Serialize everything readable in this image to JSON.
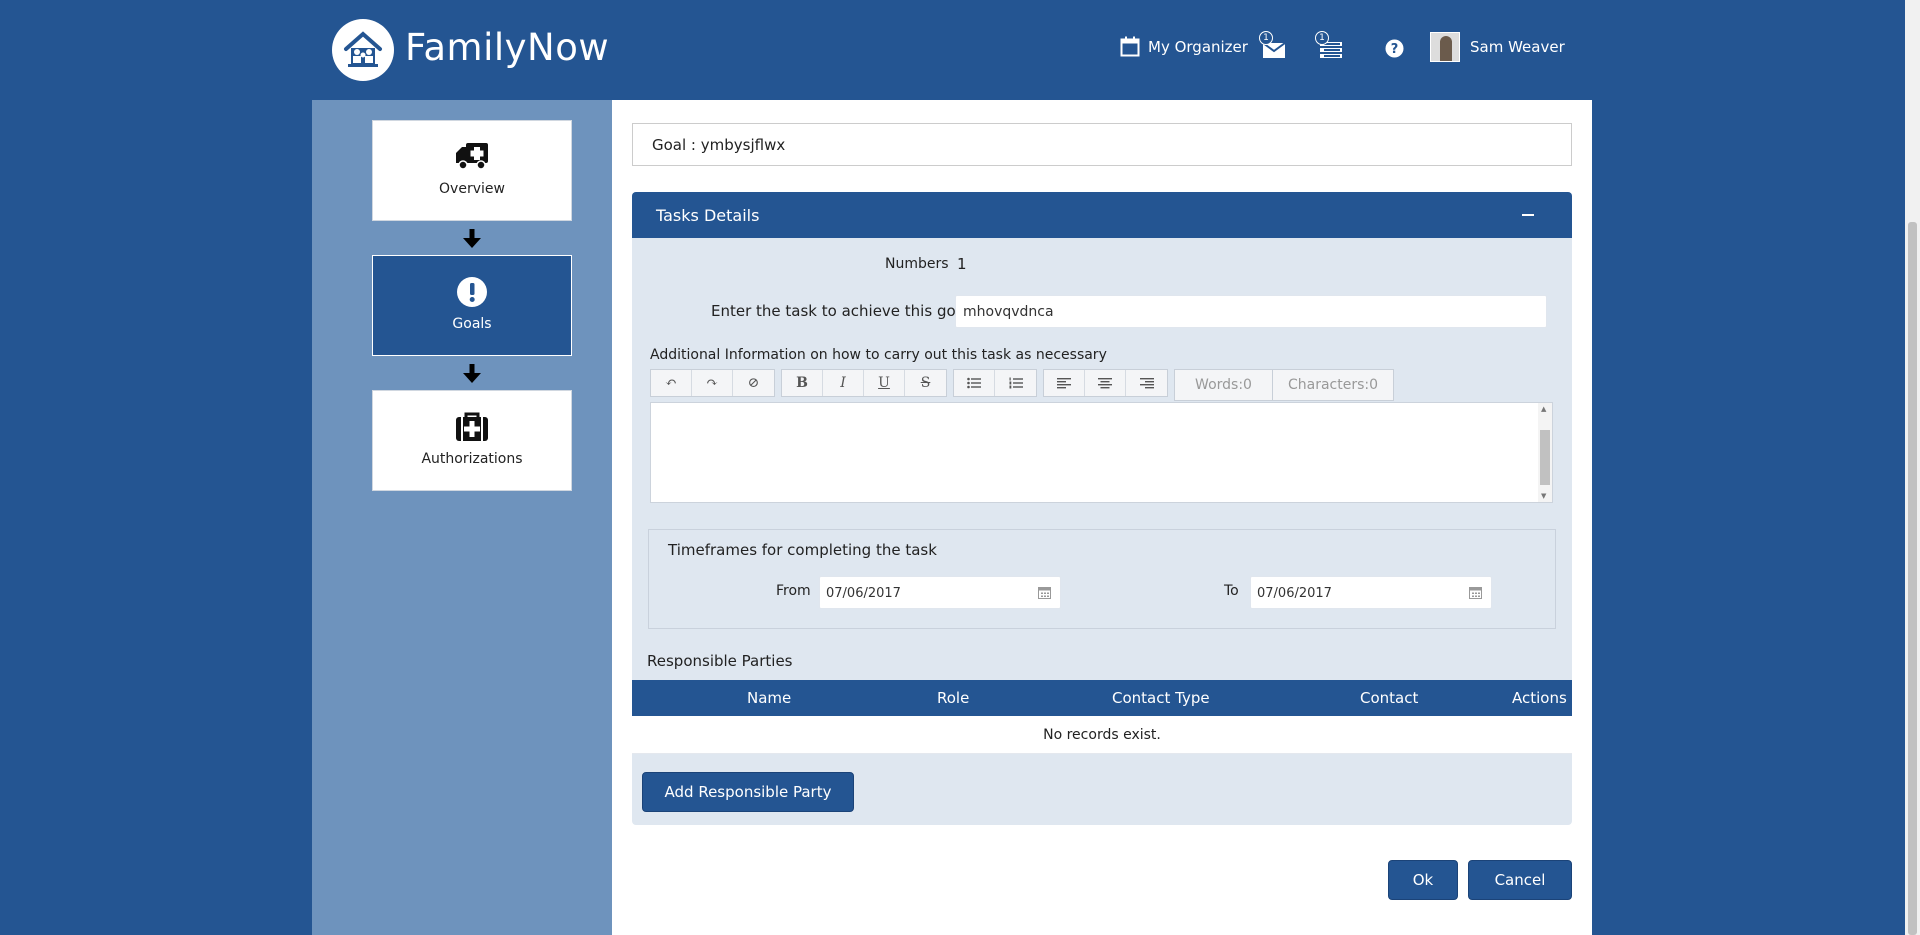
{
  "header": {
    "app_title": "FamilyNow",
    "organizer_label": "My Organizer",
    "messages_badge": "1",
    "tasks_badge": "1",
    "user_name": "Sam Weaver"
  },
  "steps": [
    {
      "label": "Overview",
      "icon": "ambulance-icon"
    },
    {
      "label": "Goals",
      "icon": "exclamation-circle-icon"
    },
    {
      "label": "Authorizations",
      "icon": "medkit-icon"
    }
  ],
  "goal": {
    "label": "Goal : ymbysjflwx"
  },
  "tasks_panel": {
    "title": "Tasks Details",
    "numbers_label": "Numbers",
    "numbers_value": "1",
    "task_label": "Enter the task to achieve this goal",
    "task_value": "mhovqvdnca",
    "additional_label": "Additional Information on how to carry out this task as necessary",
    "words_label": "Words:0",
    "characters_label": "Characters:0",
    "timeframes_title": "Timeframes for completing the task",
    "from_label": "From",
    "from_value": "07/06/2017",
    "to_label": "To",
    "to_value": "07/06/2017",
    "responsible_title": "Responsible Parties",
    "columns": [
      "Name",
      "Role",
      "Contact Type",
      "Contact",
      "Actions"
    ],
    "empty_message": "No records exist.",
    "add_button": "Add Responsible Party"
  },
  "footer": {
    "ok_label": "Ok",
    "cancel_label": "Cancel"
  },
  "colors": {
    "primary": "#245592",
    "sidebar": "#6e93bd",
    "panel_bg": "#dfe7f0",
    "required": "#e02020"
  }
}
